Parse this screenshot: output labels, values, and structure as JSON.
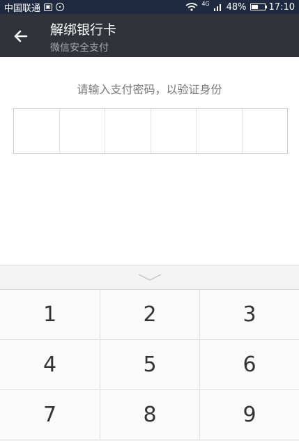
{
  "status_bar": {
    "carrier": "中国联通",
    "network": "4G",
    "battery": "48%",
    "time": "17:10"
  },
  "header": {
    "title": "解绑银行卡",
    "subtitle": "微信安全支付"
  },
  "prompt": "请输入支付密码，以验证身份",
  "password_cells": 6,
  "keypad": {
    "keys": [
      "1",
      "2",
      "3",
      "4",
      "5",
      "6",
      "7",
      "8",
      "9"
    ]
  },
  "colors": {
    "status_bg": "#1f2940",
    "header_bg": "#30343a",
    "subtitle": "#a7abb1",
    "prompt": "#777777",
    "keypad_bg": "#f4f4f4"
  },
  "icons": [
    "back-arrow-icon",
    "wifi-icon",
    "signal-icon",
    "battery-icon",
    "chevron-down-icon"
  ]
}
